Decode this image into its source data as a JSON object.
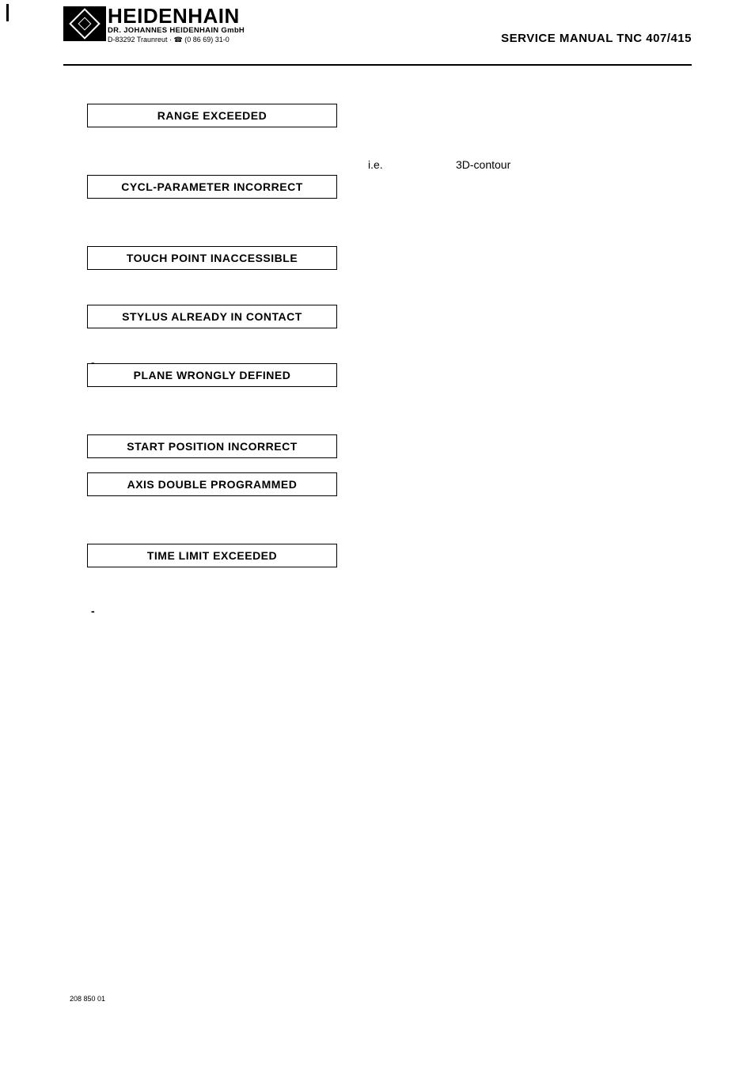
{
  "header": {
    "brand": "HEIDENHAIN",
    "company": "DR. JOHANNES HEIDENHAIN GmbH",
    "address": "D-83292 Traunreut · ☎ (0 86 69) 31-0",
    "title": "SERVICE MANUAL TNC 407/415"
  },
  "errors": [
    "RANGE  EXCEEDED",
    "CYCL-PARAMETER  INCORRECT",
    "TOUCH  POINT  INACCESSIBLE",
    "STYLUS  ALREADY  IN  CONTACT",
    "PLANE  WRONGLY  DEFINED",
    "START  POSITION  INCORRECT",
    "AXIS DOUBLE PROGRAMMED",
    "TIME  LIMIT  EXCEEDED"
  ],
  "floating": {
    "ie": "i.e.",
    "threeD": "3D-contour"
  },
  "dashes": {
    "d1": "-",
    "d2": "-"
  },
  "footer": "208 850 01"
}
